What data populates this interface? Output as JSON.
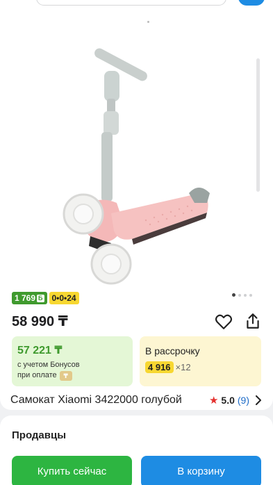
{
  "product": {
    "badges": {
      "bonus": "1 769",
      "bonus_sign": "Б",
      "installment": "0•0•24"
    },
    "price": "58 990 ₸",
    "bonus_offer": {
      "amount": "57 221 ₸",
      "note_line1": "с учетом Бонусов",
      "note_line2": "при оплате"
    },
    "installment_offer": {
      "title": "В рассрочку",
      "monthly": "4 916",
      "term": "×12"
    },
    "title": "Самокат Xiaomi 3422000 голубой",
    "rating": {
      "value": "5.0",
      "count": "(9)"
    },
    "gallery": {
      "image": "pink-kids-scooter",
      "page_count": 4,
      "active_page": 1
    }
  },
  "sellers": {
    "title": "Продавцы",
    "buy_now_label": "Купить сейчас",
    "add_to_cart_label": "В корзину"
  },
  "colors": {
    "green": "#2db541",
    "blue": "#1e8ce3",
    "yellow": "#f7d731",
    "star": "#e4302e"
  }
}
